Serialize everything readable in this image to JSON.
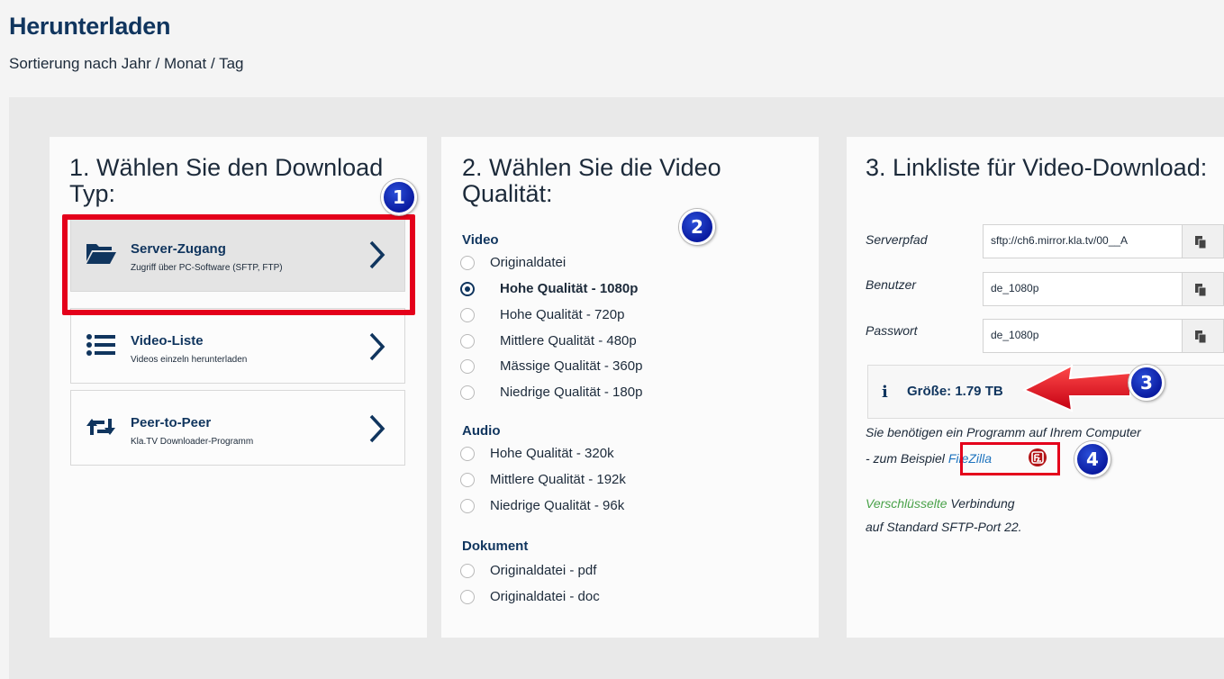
{
  "header": {
    "title": "Herunterladen",
    "subtitle": "Sortierung nach Jahr / Monat / Tag"
  },
  "panel1": {
    "title": "1. Wählen Sie den Download Typ:",
    "types": [
      {
        "label": "Server-Zugang",
        "sub": "Zugriff über PC-Software (SFTP, FTP)",
        "icon": "folder-open-icon",
        "active": true
      },
      {
        "label": "Video-Liste",
        "sub": "Videos einzeln herunterladen",
        "icon": "list-icon",
        "active": false
      },
      {
        "label": "Peer-to-Peer",
        "sub": "Kla.TV Downloader-Programm",
        "icon": "retweet-icon",
        "active": false
      }
    ]
  },
  "panel2": {
    "title": "2. Wählen Sie die Video Qualität:",
    "video_head": "Video",
    "video_options": [
      "Originaldatei",
      "Hohe Qualität - 1080p",
      "Hohe Qualität - 720p",
      "Mittlere Qualität - 480p",
      "Mässige Qualität - 360p",
      "Niedrige Qualität - 180p"
    ],
    "video_selected": 1,
    "audio_head": "Audio",
    "audio_options": [
      "Hohe Qualität - 320k",
      "Mittlere Qualität - 192k",
      "Niedrige Qualität - 96k"
    ],
    "doc_head": "Dokument",
    "doc_options": [
      "Originaldatei - pdf",
      "Originaldatei - doc"
    ]
  },
  "panel3": {
    "title": "3. Linkliste für Video-Download:",
    "fields": [
      {
        "label": "Serverpfad",
        "value": "sftp://ch6.mirror.kla.tv/00__A"
      },
      {
        "label": "Benutzer",
        "value": "de_1080p"
      },
      {
        "label": "Passwort",
        "value": "de_1080p"
      }
    ],
    "size_text": "Größe: 1.79 TB",
    "note_line1": "Sie benötigen ein Programm auf Ihrem Computer",
    "note_line2_prefix": "- zum Beispiel ",
    "filezilla_link": "FileZilla",
    "encrypted_word": "Verschlüsselte",
    "connection_word": " Verbindung",
    "port_text": "auf Standard SFTP-Port 22."
  },
  "annotations": [
    "1",
    "2",
    "3",
    "4"
  ],
  "colors": {
    "accent": "#10355e",
    "highlight": "#e4001b",
    "badge": "#0a1ba0",
    "link": "#1e73be",
    "green": "#4aa24a"
  }
}
